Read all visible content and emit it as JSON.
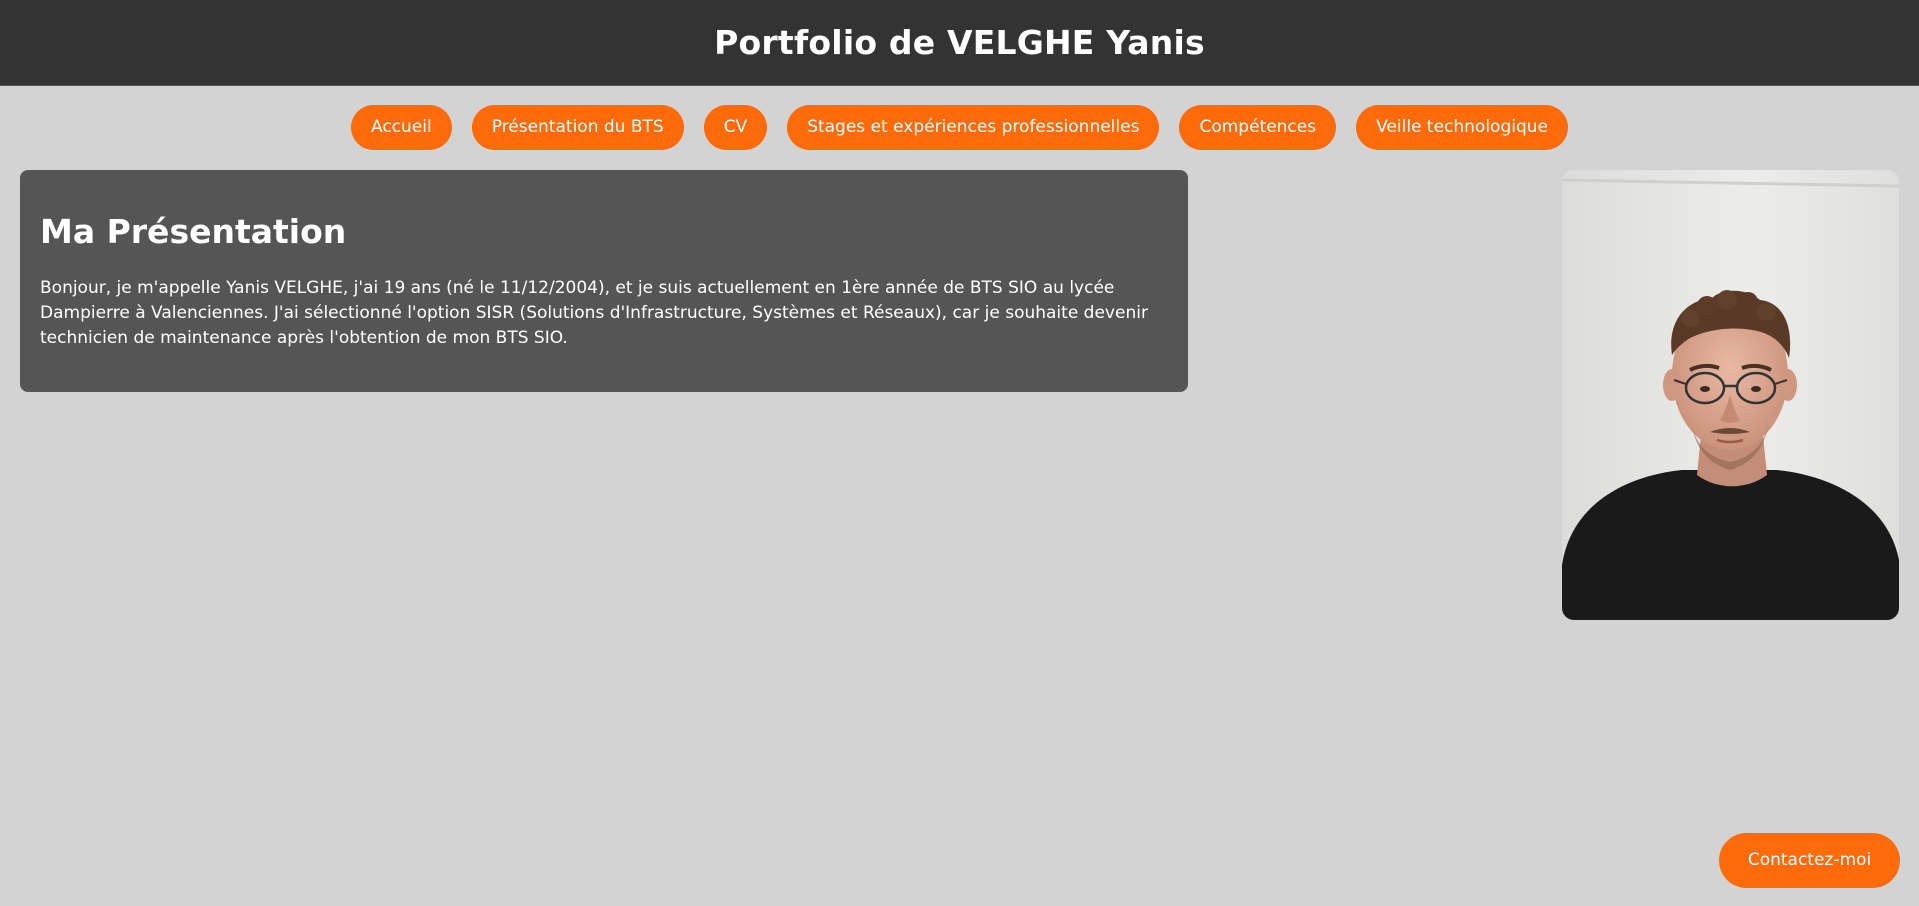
{
  "header": {
    "title": "Portfolio de VELGHE Yanis"
  },
  "nav": {
    "items": [
      {
        "label": "Accueil"
      },
      {
        "label": "Présentation du BTS"
      },
      {
        "label": "CV"
      },
      {
        "label": "Stages et expériences professionnelles"
      },
      {
        "label": "Compétences"
      },
      {
        "label": "Veille technologique"
      }
    ]
  },
  "main": {
    "title": "Ma Présentation",
    "text": "Bonjour, je m'appelle Yanis VELGHE, j'ai 19 ans (né le 11/12/2004), et je suis actuellement en 1ère année de BTS SIO au lycée Dampierre à Valenciennes. J'ai sélectionné l'option SISR (Solutions d'Infrastructure, Systèmes et Réseaux), car je souhaite devenir technicien de maintenance après l'obtention de mon BTS SIO."
  },
  "contact": {
    "label": "Contactez-moi"
  },
  "colors": {
    "accent": "#ff6a0a",
    "header_bg": "#333333",
    "page_bg": "#d3d3d3",
    "card_bg": "#555555"
  }
}
